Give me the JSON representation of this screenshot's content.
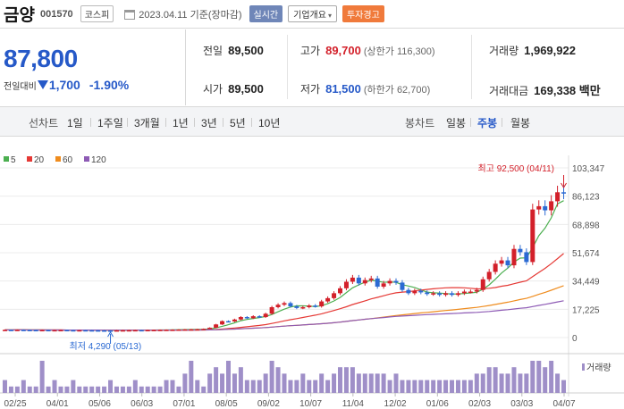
{
  "header": {
    "name": "금양",
    "code": "001570",
    "market": "코스피",
    "date": "2023.04.11 기준(장마감)",
    "realtime_label": "실시간",
    "company_label": "기업개요",
    "warning_label": "투자경고"
  },
  "price": {
    "current": "87,800",
    "change_label": "전일대비",
    "change_value": "1,700",
    "change_rate": "-1.90%"
  },
  "stats": {
    "prev_close_label": "전일",
    "prev_close": "89,500",
    "high_label": "고가",
    "high": "89,700",
    "upper_limit": "(상한가 116,300)",
    "volume_label": "거래량",
    "volume": "1,969,922",
    "open_label": "시가",
    "open": "89,500",
    "low_label": "저가",
    "low": "81,500",
    "lower_limit": "(하한가 62,700)",
    "amount_label": "거래대금",
    "amount": "169,338 백만"
  },
  "periods": {
    "line_label": "선차트",
    "line_items": [
      "1일",
      "1주일",
      "3개월",
      "1년",
      "3년",
      "5년",
      "10년"
    ],
    "candle_label": "봉차트",
    "candle_items": [
      "일봉",
      "주봉",
      "월봉"
    ],
    "active_candle": "주봉"
  },
  "chart_data": {
    "type": "candlestick",
    "legend": [
      "5",
      "20",
      "60",
      "120"
    ],
    "legend_colors": [
      "#4caf50",
      "#e53935",
      "#ef8c1e",
      "#8e5bb5"
    ],
    "y_ticks": [
      0,
      17225,
      34449,
      51674,
      68898,
      86123,
      103347
    ],
    "y_tick_labels": [
      "0",
      "17,225",
      "34,449",
      "51,674",
      "68,898",
      "86,123",
      "103,347"
    ],
    "ylim": [
      0,
      103347
    ],
    "x_tick_labels": [
      "02/25",
      "04/01",
      "05/06",
      "06/03",
      "07/01",
      "08/05",
      "09/02",
      "10/07",
      "11/04",
      "12/02",
      "01/06",
      "02/03",
      "03/03",
      "04/07"
    ],
    "high_annotation": "최고 92,500 (04/11)",
    "low_annotation": "최저 4,290 (05/13)",
    "volume_label": "거래량",
    "closes": [
      4700,
      4600,
      4700,
      4650,
      4600,
      4550,
      4600,
      4500,
      4550,
      4600,
      4500,
      4450,
      4500,
      4450,
      4400,
      4350,
      4300,
      4290,
      4400,
      4450,
      4500,
      4550,
      4500,
      4600,
      4650,
      4700,
      4750,
      4800,
      4900,
      5000,
      5050,
      5100,
      5300,
      6000,
      8000,
      10000,
      9800,
      11000,
      12500,
      11800,
      13000,
      12500,
      14500,
      18500,
      20000,
      21000,
      19000,
      18000,
      18500,
      19500,
      19000,
      22000,
      24000,
      27000,
      30000,
      34000,
      36500,
      33000,
      35000,
      36000,
      31000,
      33000,
      34500,
      33500,
      29000,
      27000,
      28500,
      27500,
      26500,
      27000,
      26000,
      27000,
      26000,
      27000,
      28000,
      28000,
      29000,
      35500,
      40000,
      45000,
      47000,
      44000,
      54000,
      52000,
      46000,
      78000,
      80000,
      77500,
      83000,
      88500,
      87800
    ],
    "volumes": [
      2,
      1,
      1,
      2,
      1,
      1,
      5,
      1,
      2,
      1,
      1,
      2,
      1,
      1,
      1,
      1,
      1,
      2,
      1,
      1,
      1,
      2,
      1,
      1,
      1,
      1,
      2,
      2,
      1,
      3,
      5,
      2,
      1,
      3,
      4,
      3,
      5,
      3,
      4,
      2,
      2,
      2,
      3,
      5,
      4,
      3,
      2,
      2,
      3,
      2,
      2,
      3,
      2,
      3,
      4,
      4,
      4,
      3,
      3,
      3,
      3,
      3,
      2,
      3,
      2,
      2,
      2,
      2,
      2,
      2,
      2,
      2,
      2,
      2,
      2,
      2,
      3,
      3,
      4,
      4,
      3,
      3,
      4,
      3,
      3,
      5,
      5,
      4,
      5,
      3,
      2
    ]
  }
}
